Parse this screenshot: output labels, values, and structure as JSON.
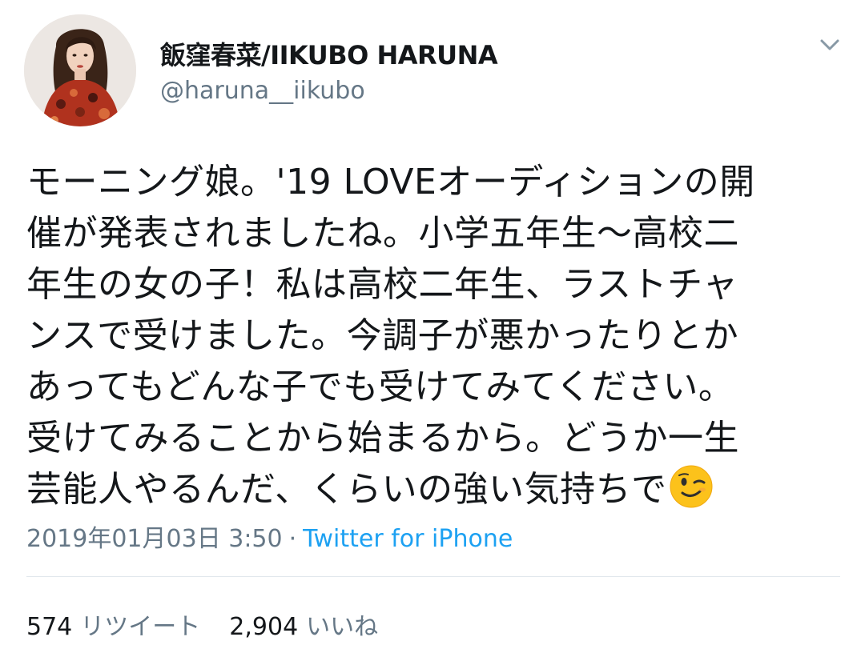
{
  "tweet": {
    "author": {
      "display_name": "飯窪春菜/IIKUBO HARUNA",
      "handle": "@haruna__iikubo"
    },
    "text_lines": [
      "モーニング娘。'19 LOVEオーディションの開",
      "催が発表されましたね。小学五年生〜高校二",
      "年生の女の子！私は高校二年生、ラストチャ",
      "ンスで受けました。今調子が悪かったりとか",
      "あってもどんな子でも受けてみてください。",
      "受けてみることから始まるから。どうか一生",
      "芸能人やるんだ、くらいの強い気持ちで"
    ],
    "emoji": "winking-face",
    "timestamp": "2019年01月03日 3:50",
    "separator": "·",
    "source": "Twitter for iPhone",
    "stats": {
      "retweets_count": "574",
      "retweets_label": "リツイート",
      "likes_count": "2,904",
      "likes_label": "いいね"
    }
  },
  "colors": {
    "text": "#14171a",
    "secondary": "#657786",
    "link": "#1da1f2",
    "divider": "#e1e8ed"
  },
  "icons": {
    "menu": "chevron-down-icon",
    "avatar": "profile-photo"
  }
}
